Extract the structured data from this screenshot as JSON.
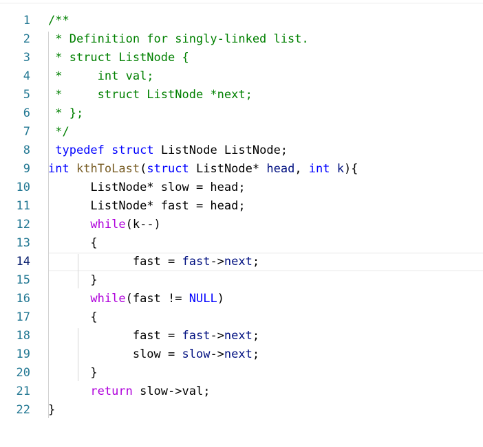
{
  "editor": {
    "language": "c",
    "active_line": 14,
    "colors": {
      "comment": "#008000",
      "keyword": "#0000ff",
      "control": "#af00db",
      "type": "#267f99",
      "function": "#795e26",
      "variable": "#001080",
      "line_number": "#237893",
      "line_number_active": "#0b216f"
    },
    "lines": [
      {
        "n": "1",
        "indent": "",
        "tokens": [
          {
            "t": "/**",
            "c": "c"
          }
        ]
      },
      {
        "n": "2",
        "indent": " ",
        "tokens": [
          {
            "t": "* Definition for singly-linked list.",
            "c": "c"
          }
        ]
      },
      {
        "n": "3",
        "indent": " ",
        "tokens": [
          {
            "t": "* struct ListNode {",
            "c": "c"
          }
        ]
      },
      {
        "n": "4",
        "indent": " ",
        "tokens": [
          {
            "t": "*     int val;",
            "c": "c"
          }
        ]
      },
      {
        "n": "5",
        "indent": " ",
        "tokens": [
          {
            "t": "*     struct ListNode *next;",
            "c": "c"
          }
        ]
      },
      {
        "n": "6",
        "indent": " ",
        "tokens": [
          {
            "t": "* };",
            "c": "c"
          }
        ]
      },
      {
        "n": "7",
        "indent": " ",
        "tokens": [
          {
            "t": "*/",
            "c": "c"
          }
        ]
      },
      {
        "n": "8",
        "indent": " ",
        "tokens": [
          {
            "t": "typedef",
            "c": "k"
          },
          {
            "t": " ",
            "c": "p"
          },
          {
            "t": "struct",
            "c": "k"
          },
          {
            "t": " ListNode ListNode;",
            "c": "p"
          }
        ]
      },
      {
        "n": "9",
        "indent": "",
        "tokens": [
          {
            "t": "int",
            "c": "k"
          },
          {
            "t": " ",
            "c": "p"
          },
          {
            "t": "kthToLast",
            "c": "f"
          },
          {
            "t": "(",
            "c": "p"
          },
          {
            "t": "struct",
            "c": "k"
          },
          {
            "t": " ListNode* ",
            "c": "p"
          },
          {
            "t": "head",
            "c": "v"
          },
          {
            "t": ", ",
            "c": "p"
          },
          {
            "t": "int",
            "c": "k"
          },
          {
            "t": " ",
            "c": "p"
          },
          {
            "t": "k",
            "c": "v"
          },
          {
            "t": "){",
            "c": "p"
          }
        ]
      },
      {
        "n": "10",
        "indent": "      ",
        "tokens": [
          {
            "t": "ListNode* slow = head;",
            "c": "p"
          }
        ]
      },
      {
        "n": "11",
        "indent": "      ",
        "tokens": [
          {
            "t": "ListNode* fast = head;",
            "c": "p"
          }
        ]
      },
      {
        "n": "12",
        "indent": "      ",
        "tokens": [
          {
            "t": "while",
            "c": "ctl"
          },
          {
            "t": "(k--)",
            "c": "p"
          }
        ]
      },
      {
        "n": "13",
        "indent": "      ",
        "tokens": [
          {
            "t": "{",
            "c": "p"
          }
        ]
      },
      {
        "n": "14",
        "indent": "            ",
        "tokens": [
          {
            "t": "fast = ",
            "c": "p"
          },
          {
            "t": "fast",
            "c": "v"
          },
          {
            "t": "->",
            "c": "p"
          },
          {
            "t": "next",
            "c": "v"
          },
          {
            "t": ";",
            "c": "p"
          }
        ]
      },
      {
        "n": "15",
        "indent": "      ",
        "tokens": [
          {
            "t": "}",
            "c": "p"
          }
        ]
      },
      {
        "n": "16",
        "indent": "      ",
        "tokens": [
          {
            "t": "while",
            "c": "ctl"
          },
          {
            "t": "(fast != ",
            "c": "p"
          },
          {
            "t": "NULL",
            "c": "k"
          },
          {
            "t": ")",
            "c": "p"
          }
        ]
      },
      {
        "n": "17",
        "indent": "      ",
        "tokens": [
          {
            "t": "{",
            "c": "p"
          }
        ]
      },
      {
        "n": "18",
        "indent": "            ",
        "tokens": [
          {
            "t": "fast = ",
            "c": "p"
          },
          {
            "t": "fast",
            "c": "v"
          },
          {
            "t": "->",
            "c": "p"
          },
          {
            "t": "next",
            "c": "v"
          },
          {
            "t": ";",
            "c": "p"
          }
        ]
      },
      {
        "n": "19",
        "indent": "            ",
        "tokens": [
          {
            "t": "slow = ",
            "c": "p"
          },
          {
            "t": "slow",
            "c": "v"
          },
          {
            "t": "->",
            "c": "p"
          },
          {
            "t": "next",
            "c": "v"
          },
          {
            "t": ";",
            "c": "p"
          }
        ]
      },
      {
        "n": "20",
        "indent": "      ",
        "tokens": [
          {
            "t": "}",
            "c": "p"
          }
        ]
      },
      {
        "n": "21",
        "indent": "      ",
        "tokens": [
          {
            "t": "return",
            "c": "ctl"
          },
          {
            "t": " slow->val;",
            "c": "p"
          }
        ]
      },
      {
        "n": "22",
        "indent": "",
        "tokens": [
          {
            "t": "}",
            "c": "p"
          }
        ]
      }
    ]
  }
}
